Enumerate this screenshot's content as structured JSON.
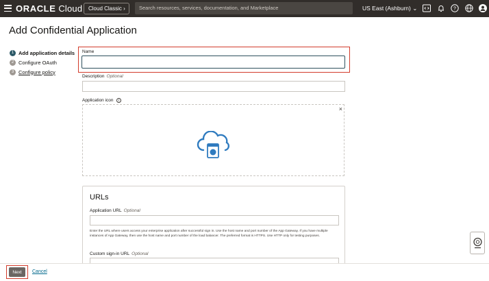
{
  "header": {
    "brand": "ORACLE",
    "product": "Cloud",
    "classic_button": "Cloud Classic",
    "search_placeholder": "Search resources, services, documentation, and Marketplace",
    "region": "US East (Ashburn)",
    "icons": [
      "menu-icon",
      "code-editor-icon",
      "bell-icon",
      "help-icon",
      "globe-icon",
      "profile-icon"
    ]
  },
  "page": {
    "title": "Add Confidential Application"
  },
  "steps": [
    {
      "number": "1",
      "label": "Add application details",
      "state": "current"
    },
    {
      "number": "2",
      "label": "Configure OAuth",
      "state": "upcoming"
    },
    {
      "number": "3",
      "label": "Configure policy",
      "state": "upcoming"
    }
  ],
  "form": {
    "name_label": "Name",
    "name_value": "",
    "description_label": "Description",
    "description_optional": "Optional",
    "description_value": "",
    "app_icon_label": "Application icon",
    "app_icon_close": "×"
  },
  "urls": {
    "title": "URLs",
    "app_url_label": "Application URL",
    "app_url_optional": "Optional",
    "app_url_help": "Enter the URL where users access your enterprise application after successful sign in. Use the host name and port number of the App Gateway. If you have multiple instances of App Gateway, then use the host name and port number of the load balancer. The preferred format is HTTPS. Use HTTP only for testing purposes.",
    "custom_signin_label": "Custom sign-in URL",
    "custom_signin_optional": "Optional"
  },
  "footer": {
    "next_label": "Next",
    "cancel_label": "Cancel"
  },
  "colors": {
    "topbar": "#312d2a",
    "highlight": "#d23a2a",
    "link": "#00688c",
    "cloud_icon": "#2f7bbf"
  }
}
